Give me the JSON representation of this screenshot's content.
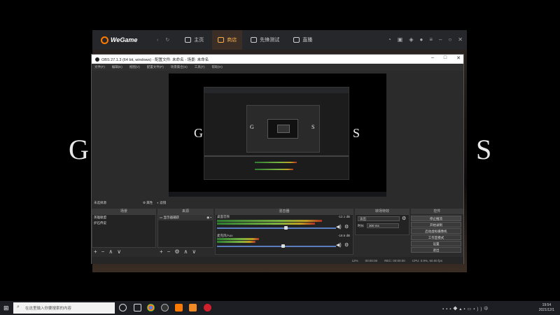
{
  "desktop": {
    "bg_letter_left": "G",
    "bg_letter_right": "S"
  },
  "wegame": {
    "logo": "WeGame",
    "tabs": [
      "主页",
      "商店",
      "先锋测试",
      "直播"
    ],
    "active_tab": "商店",
    "accent": "#ffb04a"
  },
  "obs": {
    "title": "OBS 27.1.3 (64 bit, windows) - 配置文件: 未命名 - 场景: 未命名",
    "menu": [
      "文件(F)",
      "编辑(E)",
      "视图(V)",
      "配置文件(P)",
      "场景集合(S)",
      "工具(T)",
      "帮助(H)"
    ],
    "source_bar_label": "未选择源",
    "source_bar_buttons": [
      "属性",
      "滤镜"
    ],
    "docks": {
      "scenes": "场景",
      "sources": "来源",
      "mixer": "混音器",
      "transitions": "转场特效",
      "controls": "控件"
    },
    "scene_items": [
      "英雄联盟",
      "炉石传说"
    ],
    "source_items": [
      "显示器捕获"
    ],
    "mixer_channels": [
      {
        "name": "桌面音频",
        "db": "-12.1 dB"
      },
      {
        "name": "麦克风/Aux",
        "db": "-18.6 dB"
      }
    ],
    "transition": {
      "type": "淡出",
      "duration_label": "时长",
      "duration": "300 ms"
    },
    "control_buttons": [
      "停止推流",
      "开始录制",
      "启动虚拟摄像机",
      "工作室模式",
      "设置",
      "退出"
    ],
    "status": {
      "dropped": "12%",
      "live_time": "00:00:00",
      "rec": "REC: 00:00:00",
      "cpu": "CPU: 0.9%, 60.00 fps"
    }
  },
  "taskbar": {
    "search_placeholder": "在这里输入你要搜索的内容",
    "time": "19:54",
    "date": "2021/12/1"
  }
}
